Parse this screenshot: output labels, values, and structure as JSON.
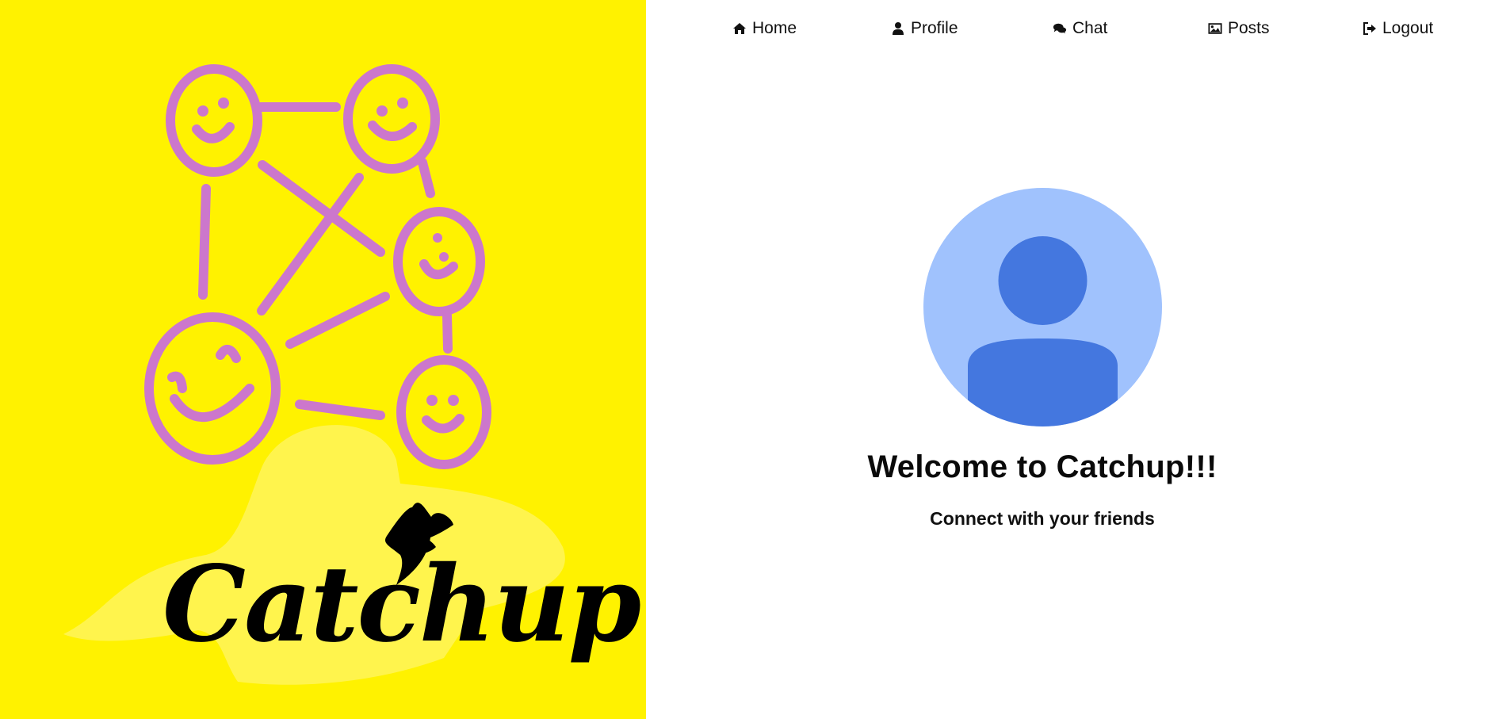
{
  "brand": {
    "logo_text": "Catchup",
    "panel_color": "#fff200",
    "accent_color": "#cc77cc"
  },
  "nav": {
    "items": [
      {
        "label": "Home",
        "icon": "home-icon"
      },
      {
        "label": "Profile",
        "icon": "user-icon"
      },
      {
        "label": "Chat",
        "icon": "chat-icon"
      },
      {
        "label": "Posts",
        "icon": "image-icon"
      },
      {
        "label": "Logout",
        "icon": "logout-icon"
      }
    ]
  },
  "main": {
    "avatar_icon": "default-avatar-icon",
    "avatar_colors": {
      "background": "#a0c2fd",
      "figure": "#4477df"
    },
    "title": "Welcome to Catchup!!!",
    "subtitle": "Connect with your friends"
  }
}
